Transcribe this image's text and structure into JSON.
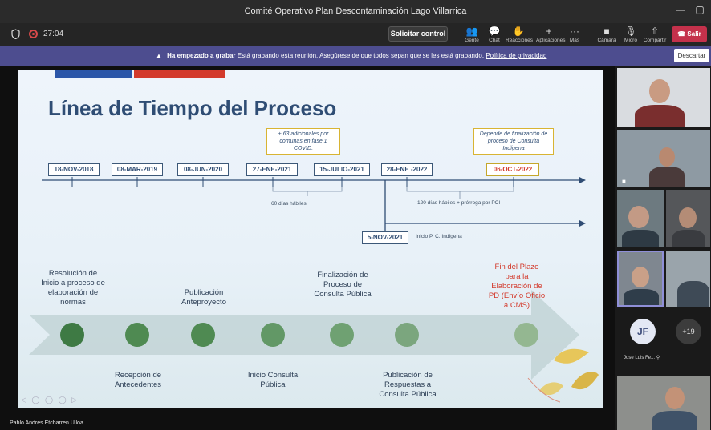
{
  "window": {
    "title": "Comité Operativo Plan Descontaminación Lago Villarrica",
    "minimize_glyph": "—",
    "maximize_glyph": "▢"
  },
  "toolbar": {
    "timer": "27:04",
    "request_control": "Solicitar control",
    "tools": [
      {
        "label": "Gente",
        "icon": "people-icon",
        "glyph": "👥"
      },
      {
        "label": "Chat",
        "icon": "chat-icon",
        "glyph": "💬"
      },
      {
        "label": "Reacciones",
        "icon": "reactions-icon",
        "glyph": "✋"
      },
      {
        "label": "Aplicaciones",
        "icon": "plus-icon",
        "glyph": "+"
      },
      {
        "label": "Más",
        "icon": "more-icon",
        "glyph": "···"
      },
      {
        "label": "Cámara",
        "icon": "camera-icon",
        "glyph": "■"
      },
      {
        "label": "Micro",
        "icon": "mic-off-icon",
        "glyph": "🎙"
      },
      {
        "label": "Compartir",
        "icon": "share-icon",
        "glyph": "⇧"
      }
    ],
    "leave": "Salir"
  },
  "banner": {
    "strong": "Ha empezado a grabar",
    "text": "Está grabando esta reunión. Asegúrese de que todos sepan que se les está grabando.",
    "link": "Política de privacidad",
    "dismiss": "Descartar"
  },
  "slide": {
    "title": "Línea de Tiempo del Proceso",
    "dates": [
      "18-NOV-2018",
      "08-MAR-2019",
      "08-JUN-2020",
      "27-ENE-2021",
      "15-JULIO-2021",
      "28-ENE -2022",
      "06-OCT-2022",
      "5-NOV-2021"
    ],
    "note_left": "+ 63 adicionales por comunas en fase 1 COVID.",
    "note_right": "Depende de finalización de proceso de Consulta Indígena",
    "span_1": "60 días hábiles",
    "span_2": "120 días hábiles + prórroga por PCI",
    "branch_label": "Inicio P. C. Indígena",
    "events_top": [
      "Resolución de Inicio a proceso de elaboración de normas",
      "Publicación Anteproyecto",
      "Finalización de Proceso de Consulta Pública",
      "Fin del Plazo para la Elaboración de PD (Envío Oficio a CMS)"
    ],
    "events_bottom": [
      "Recepción de Antecedentes",
      "Inicio Consulta Pública",
      "Publicación de Respuestas a Consulta Pública"
    ],
    "colors": {
      "title": "#2f4d74",
      "accent_red": "#d33a2c",
      "accent_blue": "#2b56a8",
      "circle": "#4f8a52"
    }
  },
  "presenter": "Pablo Andres Etcharren Ulloa",
  "gallery": {
    "avatar_initials": "JF",
    "avatar_name": "Jose Luis Fe...",
    "more_count": "+19"
  }
}
